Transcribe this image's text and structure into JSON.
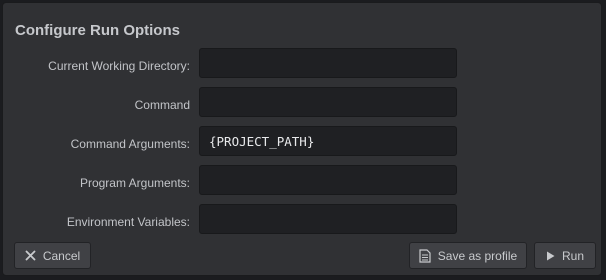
{
  "dialog": {
    "title": "Configure Run Options",
    "fields": [
      {
        "label": "Current Working Directory:",
        "value": ""
      },
      {
        "label": "Command",
        "value": ""
      },
      {
        "label": "Command Arguments:",
        "value": "{PROJECT_PATH}"
      },
      {
        "label": "Program Arguments:",
        "value": ""
      },
      {
        "label": "Environment Variables:",
        "value": ""
      }
    ],
    "buttons": {
      "cancel": {
        "label": "Cancel",
        "icon": "close-icon"
      },
      "save_profile": {
        "label": "Save as profile",
        "icon": "document-icon"
      },
      "run": {
        "label": "Run",
        "icon": "play-icon"
      }
    }
  },
  "colors": {
    "dialog_bg": "#303134",
    "field_bg": "#1f2023",
    "button_bg": "#404145",
    "text": "#c2c4c8"
  }
}
